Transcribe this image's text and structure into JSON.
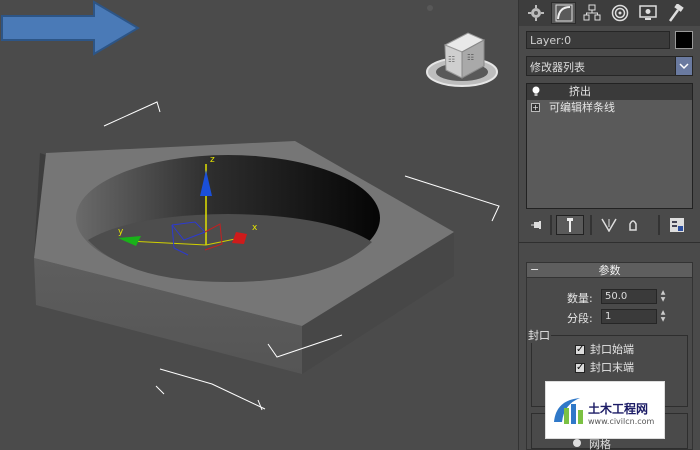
{
  "viewport": {
    "axes": {
      "z": "z",
      "x": "x",
      "y": "y"
    },
    "viewcube_icons": [
      "viewcube-icon",
      "home-icon"
    ]
  },
  "command_panel": {
    "tabs": [
      {
        "name": "create-tab",
        "icon": "sun-gear-icon"
      },
      {
        "name": "modify-tab",
        "icon": "curve-bend-icon",
        "active": true
      },
      {
        "name": "hierarchy-tab",
        "icon": "hierarchy-icon"
      },
      {
        "name": "motion-tab",
        "icon": "motion-disc-icon"
      },
      {
        "name": "display-tab",
        "icon": "monitor-icon"
      },
      {
        "name": "utilities-tab",
        "icon": "hammer-icon"
      }
    ],
    "object_name": "Layer:0",
    "object_color": "#000000",
    "modifier_list": "修改器列表",
    "stack": [
      {
        "label": "挤出",
        "selected": true,
        "icon": "lightbulb-icon"
      },
      {
        "label": "可编辑样条线",
        "selected": false,
        "icon": "expand-plus-icon"
      }
    ],
    "stack_tools": [
      "pin-stack-icon",
      "show-end-result-icon",
      "make-unique-icon",
      "remove-modifier-icon",
      "configure-sets-icon"
    ],
    "parameters": {
      "title": "参数",
      "collapse": "−",
      "amount_label": "数量:",
      "amount_value": "50.0",
      "segments_label": "分段:",
      "segments_value": "1",
      "capping_title": "封口",
      "cap_start": "封口始端",
      "cap_end": "封口末端",
      "output_option": "网格"
    }
  },
  "watermark": {
    "text": "土木工程网",
    "url": "www.civilcn.com"
  }
}
